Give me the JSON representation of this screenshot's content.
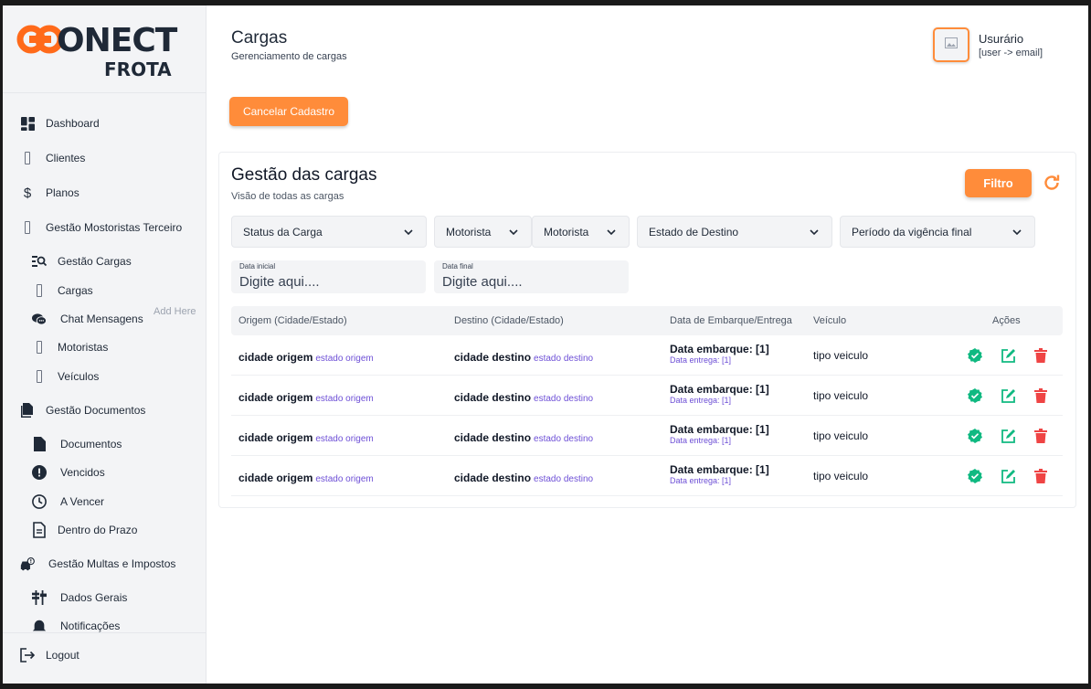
{
  "brand": {
    "logo_word": "ONECT",
    "logo_sub": "FROTA"
  },
  "sidebar": {
    "items": [
      {
        "label": "Dashboard",
        "icon": "dashboard-icon"
      },
      {
        "label": "Clientes",
        "icon": "placeholder-icon"
      },
      {
        "label": "Planos",
        "icon": "dollar-icon"
      },
      {
        "label": "Gestão Mostoristas Terceiro",
        "icon": "placeholder-icon"
      },
      {
        "label": "Gestão Cargas",
        "icon": "search-list-icon"
      },
      {
        "label": "Cargas",
        "icon": "placeholder-icon"
      },
      {
        "label": "Chat Mensagens",
        "icon": "chat-icon"
      },
      {
        "label": "Motoristas",
        "icon": "placeholder-icon"
      },
      {
        "label": "Veículos",
        "icon": "placeholder-icon"
      },
      {
        "label": "Gestão Documentos",
        "icon": "documents-icon"
      },
      {
        "label": "Documentos",
        "icon": "document-icon"
      },
      {
        "label": "Vencidos",
        "icon": "alert-icon"
      },
      {
        "label": "A Vencer",
        "icon": "clock-icon"
      },
      {
        "label": "Dentro do Prazo",
        "icon": "file-text-icon"
      },
      {
        "label": "Gestão Multas e Impostos",
        "icon": "car-alert-icon"
      },
      {
        "label": "Dados Gerais",
        "icon": "signpost-icon"
      },
      {
        "label": "Notificações",
        "icon": "bell-icon"
      }
    ],
    "add_here": "Add Here",
    "logout": "Logout"
  },
  "header": {
    "title": "Cargas",
    "subtitle": "Gerenciamento de cargas",
    "user_name": "Usurário",
    "user_email": "[user -> email]"
  },
  "cancel_button": "Cancelar Cadastro",
  "card": {
    "title": "Gestão das cargas",
    "subtitle": "Visão de todas as cargas",
    "filter_button": "Filtro"
  },
  "filters": {
    "status": "Status da Carga",
    "motorista_1": "Motorista",
    "motorista_2": "Motorista",
    "estado_destino": "Estado de Destino",
    "periodo": "Período da vigência final",
    "data_inicial_label": "Data inicial",
    "data_inicial_placeholder": "Digite aqui....",
    "data_final_label": "Data final",
    "data_final_placeholder": "Digite aqui...."
  },
  "table": {
    "headers": {
      "origem": "Origem (Cidade/Estado)",
      "destino": "Destino (Cidade/Estado)",
      "datas": "Data de Embarque/Entrega",
      "veiculo": "Veículo",
      "acoes": "Ações"
    },
    "rows": [
      {
        "cidade_origem": "cidade origem",
        "estado_origem": "estado origem",
        "cidade_destino": "cidade destino",
        "estado_destino": "estado destino",
        "embarque": "Data embarque: [1]",
        "entrega": "Data entrega: [1]",
        "veiculo": "tipo veiculo"
      },
      {
        "cidade_origem": "cidade origem",
        "estado_origem": "estado origem",
        "cidade_destino": "cidade destino",
        "estado_destino": "estado destino",
        "embarque": "Data embarque: [1]",
        "entrega": "Data entrega: [1]",
        "veiculo": "tipo veiculo"
      },
      {
        "cidade_origem": "cidade origem",
        "estado_origem": "estado origem",
        "cidade_destino": "cidade destino",
        "estado_destino": "estado destino",
        "embarque": "Data embarque: [1]",
        "entrega": "Data entrega: [1]",
        "veiculo": "tipo veiculo"
      },
      {
        "cidade_origem": "cidade origem",
        "estado_origem": "estado origem",
        "cidade_destino": "cidade destino",
        "estado_destino": "estado destino",
        "embarque": "Data embarque: [1]",
        "entrega": "Data entrega: [1]",
        "veiculo": "tipo veiculo"
      }
    ]
  },
  "colors": {
    "accent": "#ff8c3a",
    "approve": "#10b981",
    "edit": "#10b981",
    "delete": "#ef4444",
    "state_link": "#6d4fd6"
  }
}
